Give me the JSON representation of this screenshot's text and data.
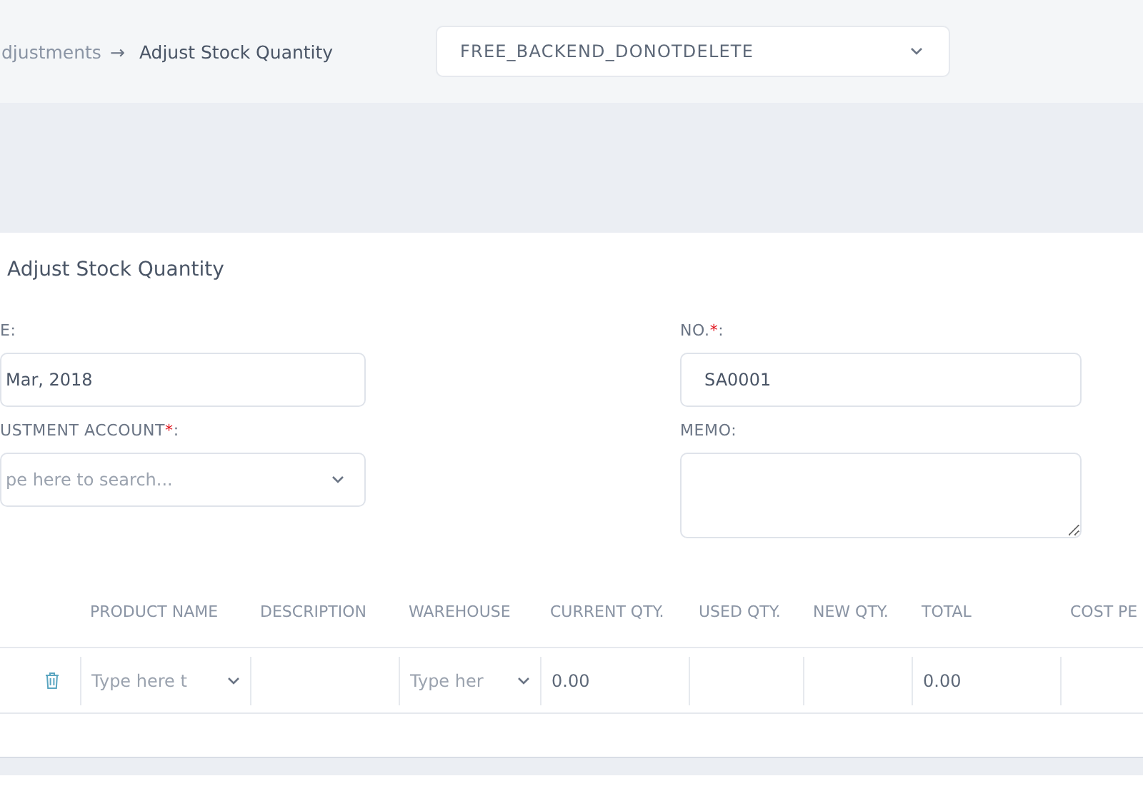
{
  "breadcrumb": {
    "parent": "djustments",
    "arrow": "→",
    "current": "Adjust Stock Quantity"
  },
  "company_select": {
    "value": "FREE_BACKEND_DONOTDELETE"
  },
  "form": {
    "title": "Adjust Stock Quantity",
    "required_mark": "*",
    "fields": [
      {
        "label": "E:",
        "value": "Mar, 2018",
        "kind": "text",
        "required": false
      },
      {
        "label": "NO.",
        "colon": ":",
        "value": "SA0001",
        "kind": "text",
        "required": true
      },
      {
        "label": "USTMENT ACCOUNT",
        "colon": ":",
        "placeholder": "pe here to search...",
        "kind": "select",
        "required": true
      },
      {
        "label": "MEMO:",
        "kind": "textarea",
        "required": false
      }
    ]
  },
  "table": {
    "columns": [
      "PRODUCT NAME",
      "DESCRIPTION",
      "WAREHOUSE",
      "CURRENT QTY.",
      "USED QTY.",
      "NEW QTY.",
      "TOTAL",
      "COST PE"
    ],
    "rows": [
      {
        "product_placeholder": "Type here t",
        "description": "",
        "warehouse_placeholder": "Type her",
        "current_qty": "0.00",
        "used_qty": "",
        "new_qty": "",
        "total": "0.00",
        "cost": ""
      }
    ]
  }
}
